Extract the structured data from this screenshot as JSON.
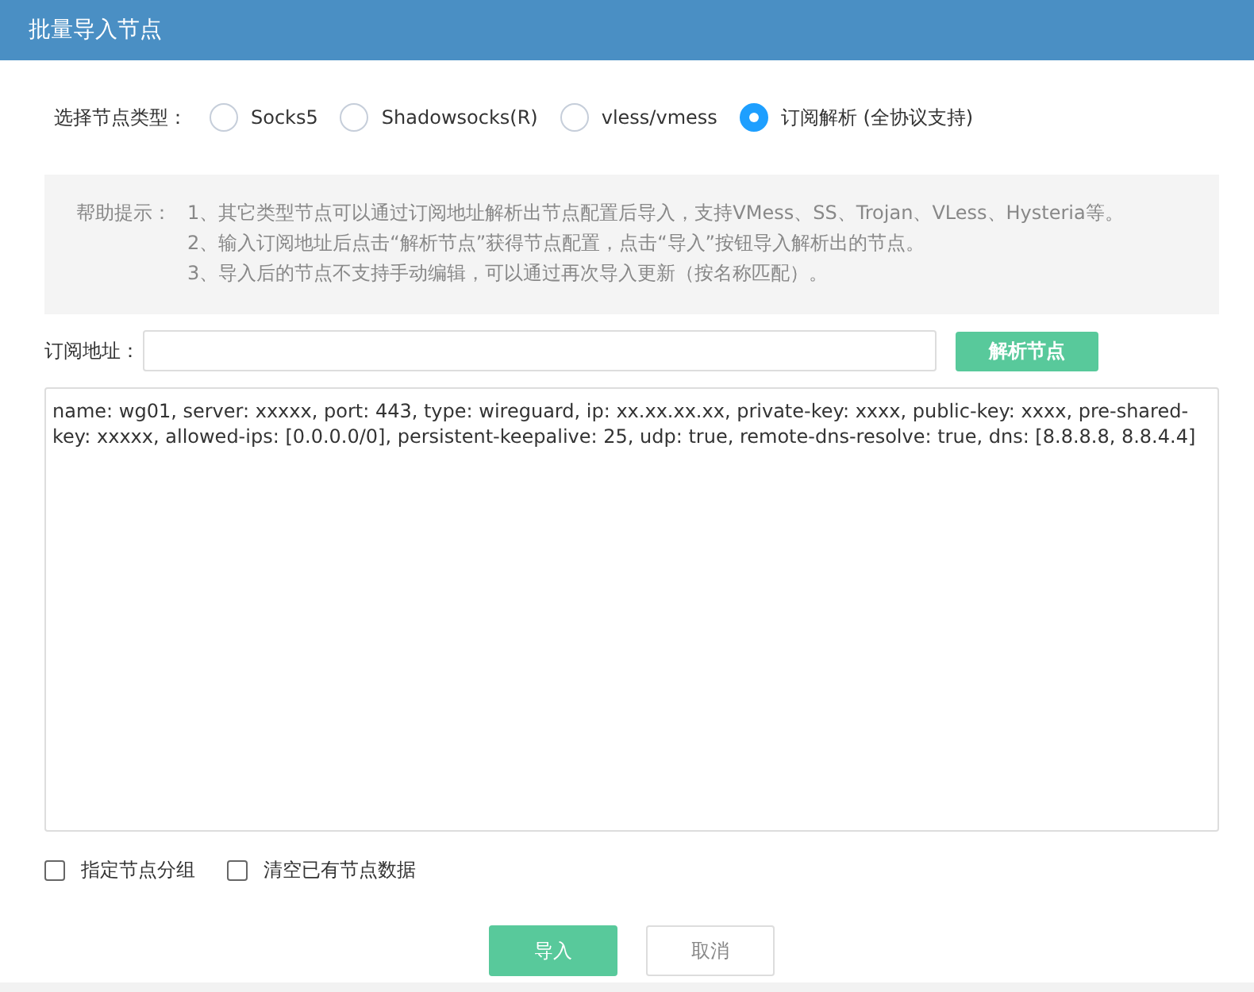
{
  "window": {
    "title": "批量导入节点"
  },
  "node_type": {
    "label": "选择节点类型：",
    "options": [
      {
        "label": "Socks5",
        "selected": false
      },
      {
        "label": "Shadowsocks(R)",
        "selected": false
      },
      {
        "label": "vless/vmess",
        "selected": false
      },
      {
        "label": "订阅解析 (全协议支持)",
        "selected": true
      }
    ]
  },
  "help": {
    "label": "帮助提示：",
    "lines": [
      "1、其它类型节点可以通过订阅地址解析出节点配置后导入，支持VMess、SS、Trojan、VLess、Hysteria等。",
      "2、输入订阅地址后点击“解析节点”获得节点配置，点击“导入”按钮导入解析出的节点。",
      "3、导入后的节点不支持手动编辑，可以通过再次导入更新（按名称匹配）。"
    ]
  },
  "subscription": {
    "label": "订阅地址：",
    "button": "解析节点"
  },
  "config_text": "name: wg01, server: xxxxx, port: 443, type: wireguard, ip: xx.xx.xx.xx, private-key: xxxx, public-key: xxxx, pre-shared-key: xxxxx, allowed-ips: [0.0.0.0/0], persistent-keepalive: 25, udp: true, remote-dns-resolve: true, dns: [8.8.8.8, 8.8.4.4]",
  "options": [
    {
      "label": "指定节点分组",
      "checked": false
    },
    {
      "label": "清空已有节点数据",
      "checked": false
    }
  ],
  "buttons": [
    {
      "label": "导入",
      "kind": "primary"
    },
    {
      "label": "取消",
      "kind": "secondary"
    }
  ]
}
